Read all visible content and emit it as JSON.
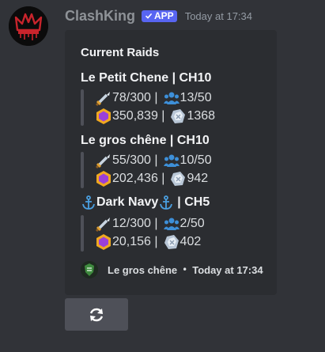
{
  "message": {
    "author": "ClashKing",
    "app_tag": "APP",
    "timestamp": "Today at 17:34",
    "avatar_icon": "crown-avatar-icon"
  },
  "embed": {
    "title": "Current Raids",
    "raids": [
      {
        "name": "Le Petit Chene | CH10",
        "attacks": "78/300 |",
        "members": "13/50",
        "loot": "350,839 |",
        "medals": "1368"
      },
      {
        "name": "Le gros chêne | CH10",
        "attacks": "55/300 |",
        "members": "10/50",
        "loot": "202,436 |",
        "medals": "942"
      },
      {
        "name_left": "Dark Navy",
        "name_right": "| CH5",
        "attacks": "12/300 |",
        "members": "2/50",
        "loot": "20,156 |",
        "medals": "402"
      }
    ],
    "footer": {
      "name": "Le gros chêne",
      "separator": "•",
      "time": "Today at 17:34"
    }
  },
  "components": {
    "refresh_icon": "refresh-icon"
  },
  "colors": {
    "background": "#313338",
    "embed": "#2b2d31",
    "blurple": "#5865f2",
    "button": "#4e5058"
  }
}
